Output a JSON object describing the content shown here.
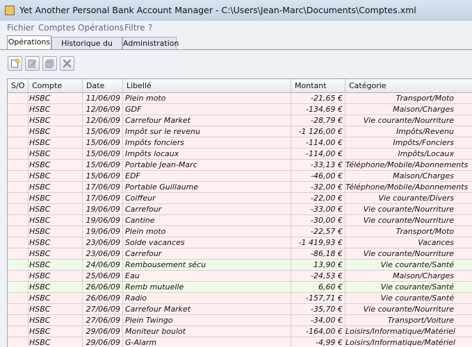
{
  "window": {
    "title": "Yet Another Personal Bank Account Manager - C:\\Users\\Jean-Marc\\Documents\\Comptes.xml"
  },
  "menu": [
    "Fichier",
    "Comptes",
    "Opérations",
    "Filtre",
    "?"
  ],
  "tabs": [
    "Opérations",
    "Historique du solde",
    "Administration"
  ],
  "toolbar": {
    "icons": [
      "new-operation-icon",
      "edit-operation-icon",
      "duplicate-operation-icon",
      "delete-operation-icon"
    ]
  },
  "colors": {
    "expense_row": "#fff0f0",
    "income_row": "#eefbe9"
  },
  "table": {
    "columns": [
      "S/O",
      "Compte",
      "Date",
      "Libellé",
      "Montant",
      "Catégorie"
    ],
    "rows": [
      {
        "so": "",
        "compte": "HSBC",
        "date": "11/06/09",
        "libelle": "Plein moto",
        "montant": "-21,65 €",
        "categorie": "Transport/Moto",
        "type": "expense"
      },
      {
        "so": "",
        "compte": "HSBC",
        "date": "12/06/09",
        "libelle": "GDF",
        "montant": "-134,69 €",
        "categorie": "Maison/Charges",
        "type": "expense"
      },
      {
        "so": "",
        "compte": "HSBC",
        "date": "12/06/09",
        "libelle": "Carrefour Market",
        "montant": "-28,79 €",
        "categorie": "Vie courante/Nourriture",
        "type": "expense"
      },
      {
        "so": "",
        "compte": "HSBC",
        "date": "15/06/09",
        "libelle": "Impôt sur le revenu",
        "montant": "-1 126,00 €",
        "categorie": "Impôts/Revenu",
        "type": "expense"
      },
      {
        "so": "",
        "compte": "HSBC",
        "date": "15/06/09",
        "libelle": "Impôts fonciers",
        "montant": "-114,00 €",
        "categorie": "Impôts/Fonciers",
        "type": "expense"
      },
      {
        "so": "",
        "compte": "HSBC",
        "date": "15/06/09",
        "libelle": "Impôts locaux",
        "montant": "-114,00 €",
        "categorie": "Impôts/Locaux",
        "type": "expense"
      },
      {
        "so": "",
        "compte": "HSBC",
        "date": "15/06/09",
        "libelle": "Portable Jean-Marc",
        "montant": "-33,13 €",
        "categorie": "Téléphone/Mobile/Abonnements",
        "type": "expense"
      },
      {
        "so": "",
        "compte": "HSBC",
        "date": "15/06/09",
        "libelle": "EDF",
        "montant": "-46,00 €",
        "categorie": "Maison/Charges",
        "type": "expense"
      },
      {
        "so": "",
        "compte": "HSBC",
        "date": "17/06/09",
        "libelle": "Portable Guillaume",
        "montant": "-32,00 €",
        "categorie": "Téléphone/Mobile/Abonnements",
        "type": "expense"
      },
      {
        "so": "",
        "compte": "HSBC",
        "date": "17/06/09",
        "libelle": "Coiffeur",
        "montant": "-22,00 €",
        "categorie": "Vie courante/Divers",
        "type": "expense"
      },
      {
        "so": "",
        "compte": "HSBC",
        "date": "19/06/09",
        "libelle": "Carrefour",
        "montant": "-33,00 €",
        "categorie": "Vie courante/Nourriture",
        "type": "expense"
      },
      {
        "so": "",
        "compte": "HSBC",
        "date": "19/06/09",
        "libelle": "Cantine",
        "montant": "-30,00 €",
        "categorie": "Vie courante/Nourriture",
        "type": "expense"
      },
      {
        "so": "",
        "compte": "HSBC",
        "date": "19/06/09",
        "libelle": "Plein moto",
        "montant": "-22,57 €",
        "categorie": "Transport/Moto",
        "type": "expense"
      },
      {
        "so": "",
        "compte": "HSBC",
        "date": "23/06/09",
        "libelle": "Solde vacances",
        "montant": "-1 419,93 €",
        "categorie": "Vacances",
        "type": "expense"
      },
      {
        "so": "",
        "compte": "HSBC",
        "date": "23/06/09",
        "libelle": "Carrefour",
        "montant": "-86,18 €",
        "categorie": "Vie courante/Nourriture",
        "type": "expense"
      },
      {
        "so": "",
        "compte": "HSBC",
        "date": "24/06/09",
        "libelle": "Rembousement sécu",
        "montant": "13,90 €",
        "categorie": "Vie courante/Santé",
        "type": "income"
      },
      {
        "so": "",
        "compte": "HSBC",
        "date": "25/06/09",
        "libelle": "Eau",
        "montant": "-24,53 €",
        "categorie": "Maison/Charges",
        "type": "expense"
      },
      {
        "so": "",
        "compte": "HSBC",
        "date": "26/06/09",
        "libelle": "Remb mutuelle",
        "montant": "6,60 €",
        "categorie": "Vie courante/Santé",
        "type": "income"
      },
      {
        "so": "",
        "compte": "HSBC",
        "date": "26/06/09",
        "libelle": "Radio",
        "montant": "-157,71 €",
        "categorie": "Vie courante/Santé",
        "type": "expense"
      },
      {
        "so": "",
        "compte": "HSBC",
        "date": "27/06/09",
        "libelle": "Carrefour Market",
        "montant": "-35,70 €",
        "categorie": "Vie courante/Nourriture",
        "type": "expense"
      },
      {
        "so": "",
        "compte": "HSBC",
        "date": "27/06/09",
        "libelle": "Plein Twingo",
        "montant": "-34,00 €",
        "categorie": "Transport/Voiture",
        "type": "expense"
      },
      {
        "so": "",
        "compte": "HSBC",
        "date": "29/06/09",
        "libelle": "Moniteur boulot",
        "montant": "-164,00 €",
        "categorie": "Loisirs/Informatique/Matériel",
        "type": "expense"
      },
      {
        "so": "",
        "compte": "HSBC",
        "date": "29/06/09",
        "libelle": "G-Alarm",
        "montant": "-4,99 €",
        "categorie": "Loisirs/Informatique/Matériel",
        "type": "expense"
      }
    ]
  }
}
